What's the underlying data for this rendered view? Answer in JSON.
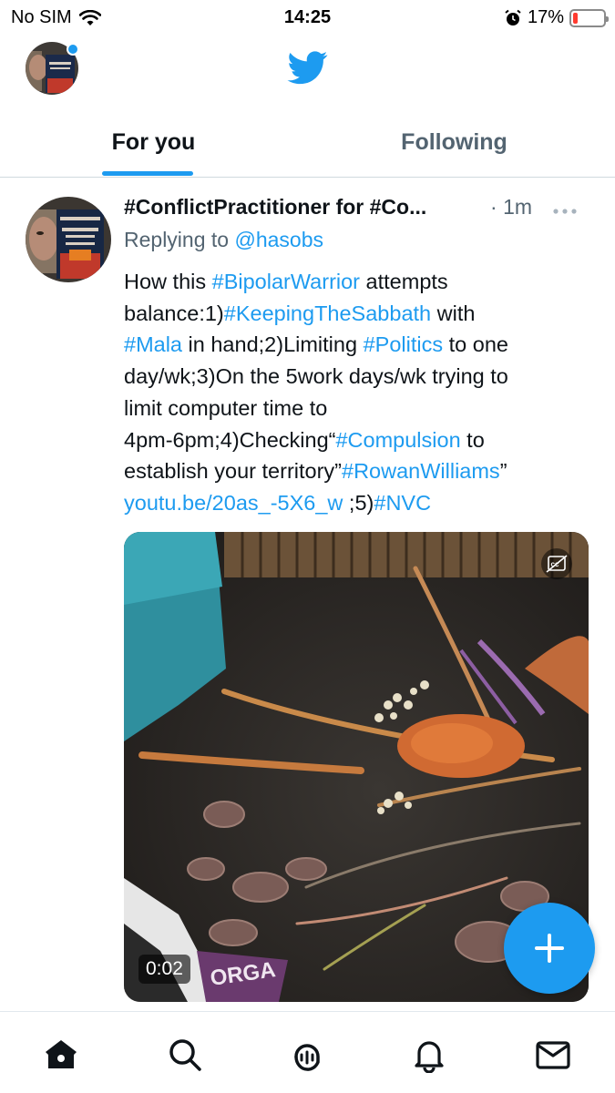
{
  "status_bar": {
    "carrier": "No SIM",
    "time": "14:25",
    "battery_percent": "17%",
    "battery_level": 0.17,
    "battery_color": "#ff3b30"
  },
  "header": {
    "logo": "twitter-bird-icon",
    "accent_color": "#1d9bf0"
  },
  "tabs": [
    {
      "label": "For you",
      "active": true
    },
    {
      "label": "Following",
      "active": false
    }
  ],
  "tweet": {
    "author_name": "#ConflictPractitioner for #Co...",
    "separator": "·",
    "time": "1m",
    "reply_prefix": "Replying to",
    "reply_handle": "@hasobs",
    "body": {
      "l1": {
        "a": "How this ",
        "b": "#BipolarWarrior",
        "c": " attempts"
      },
      "l2": {
        "a": "balance:1)",
        "b": "#KeepingTheSabbath",
        "c": " with"
      },
      "l3": {
        "a": "#Mala",
        "b": " in hand;2)Limiting ",
        "c": "#Politics",
        "d": " to one"
      },
      "l4": "day/wk;3)On the 5work days/wk trying to",
      "l5": "limit computer time to",
      "l6": {
        "a": "4pm-6pm;4)Checking“",
        "b": "#Compulsion",
        "c": " to"
      },
      "l7": {
        "a": "establish your territory”",
        "b": "#RowanWilliams",
        "c": "”"
      },
      "l8": {
        "a": "youtu.be/20as_-5X6_w",
        "b": " ;5)",
        "c": "#NVC"
      }
    },
    "media": {
      "duration": "0:02",
      "caption_icon": "closed-captions-icon",
      "overlay_text": "ORGA"
    }
  },
  "fab": {
    "icon": "plus-icon"
  },
  "bottom_nav": [
    {
      "icon": "home-icon",
      "active": true
    },
    {
      "icon": "search-icon",
      "active": false
    },
    {
      "icon": "spaces-icon",
      "active": false
    },
    {
      "icon": "bell-icon",
      "active": false
    },
    {
      "icon": "mail-icon",
      "active": false
    }
  ]
}
